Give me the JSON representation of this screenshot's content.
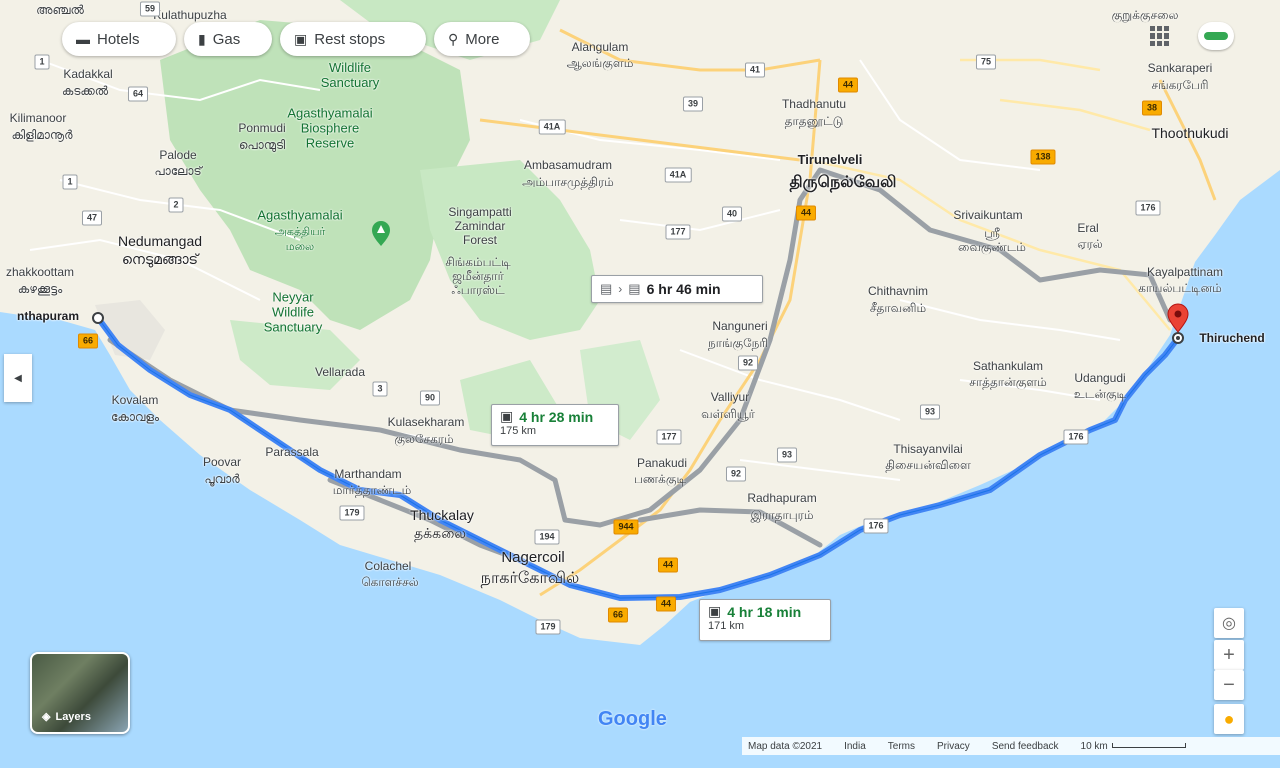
{
  "toolbar": {
    "chips": [
      {
        "label": "Hotels",
        "icon": "bed-icon"
      },
      {
        "label": "Gas",
        "icon": "gas-station-icon"
      },
      {
        "label": "Rest stops",
        "icon": "car-icon"
      },
      {
        "label": "More",
        "icon": "search-icon"
      }
    ]
  },
  "routes": {
    "transit": {
      "time": "6 hr 46 min"
    },
    "alt": {
      "time": "4 hr 28 min",
      "distance": "175 km"
    },
    "main": {
      "time": "4 hr 18 min",
      "distance": "171 km"
    }
  },
  "places": {
    "origin": "nthapuram",
    "destination": "Thiruchend",
    "kulathupuzha": "Kulathupuzha",
    "alangulam": "Alangulam",
    "alangulam_ta": "ஆலங்குளம்",
    "kadakkal": "Kadakkal",
    "kadakkal_ml": "കടക്കൽ",
    "kilimanoor": "Kilimanoor",
    "kilimanoor_ml": "കിളിമാനൂർ",
    "ponmudi": "Ponmudi",
    "ponmudi_ml": "പൊന്മുടി",
    "palode": "Palode",
    "palode_ml": "പാലോട്",
    "nedumangad": "Nedumangad",
    "nedumangad_ml": "നെടുമങ്ങാട്",
    "kazhakkoottam": "zhakkoottam",
    "kazhakkoottam_ml": "കഴക്കൂട്ടം",
    "kovalam": "Kovalam",
    "kovalam_ml": "കോവളം",
    "poovar": "Poovar",
    "poovar_ml": "പൂവാർ",
    "parassala": "Parassala",
    "vellarada": "Vellarada",
    "wildlife_sanctuary": "Wildlife\nSanctuary",
    "agasthyamalai_biosphere": "Agasthyamalai\nBiosphere\nReserve",
    "agasthyamalai": "Agasthyamalai",
    "agasthyamalai_ta": "அகத்தியர்\nமலை",
    "neyyar": "Neyyar\nWildlife\nSanctuary",
    "singampatti": "Singampatti\nZamindar\nForest",
    "singampatti_ta": "சிங்கம்பட்டி\nஜமீன்தார்\nஃபாரஸ்ட்",
    "ambasamudram": "Ambasamudram",
    "ambasamudram_ta": "அம்பாசமுத்திரம்",
    "thadhanutu": "Thadhanutu",
    "thadhanutu_ta": "தாதனூட்டு",
    "tirunelveli": "Tirunelveli",
    "tirunelveli_ta": "திருநெல்வேலி",
    "sankaraperi": "Sankaraperi",
    "sankaraperi_ta": "சங்கரபேரி",
    "thoothukudi": "Thoothukudi",
    "kurukkusalai_ta": "குறுக்குசலை",
    "srivaikuntam": "Srivaikuntam",
    "srivaikuntam_ta": "ஸ்ரீ\nவைகுண்டம்",
    "eral": "Eral",
    "eral_ta": "ஏரல்",
    "kayalpattinam": "Kayalpattinam",
    "kayalpattinam_ta": "காயல்பட்டினம்",
    "chithavnim": "Chithavnim",
    "chithavnim_ta": "சீதாவனிம்",
    "nanguneri": "Nanguneri",
    "nanguneri_ta": "நாங்குநேரி",
    "valliyur": "Valliyur",
    "valliyur_ta": "வள்ளியூர்",
    "sathankulam": "Sathankulam",
    "sathankulam_ta": "சாத்தான்குளம்",
    "udangudi": "Udangudi",
    "udangudi_ta": "உடன்குடி",
    "kulasekharam": "Kulasekharam",
    "kulasekharam_ta": "குலசேகரம்",
    "marthandam": "Marthandam",
    "marthandam_ta": "மார்த்தாண்டம்",
    "thuckalay": "Thuckalay",
    "thuckalay_ta": "தக்கலை",
    "panakudi": "Panakudi",
    "panakudi_ta": "பணக்குடி",
    "thisayanvilai": "Thisayanvilai",
    "thisayanvilai_ta": "திசையன்விளை",
    "radhapuram": "Radhapuram",
    "radhapuram_ta": "இராதாபுரம்",
    "nagercoil": "Nagercoil",
    "nagercoil_ta": "நாகர்கோவில்",
    "colachel": "Colachel",
    "colachel_ta": "கொளச்சல்",
    "anchal_ml": "അഞ്ചൽ"
  },
  "shields": {
    "s59": "59",
    "s1": "1",
    "s64": "64",
    "s1b": "1",
    "s2": "2",
    "s47": "47",
    "s66a": "66",
    "s3": "3",
    "s90": "90",
    "s179a": "179",
    "s179b": "179",
    "s66b": "66",
    "s44a": "44",
    "s44b": "44",
    "s194": "194",
    "s944": "944",
    "s177": "177",
    "s40": "40",
    "s41a": "41A",
    "s41b": "41A",
    "s39": "39",
    "s41": "41",
    "s44c": "44",
    "s75": "75",
    "s38": "38",
    "s138": "138",
    "s176a": "176",
    "s176b": "176",
    "s176c": "176",
    "s93a": "93",
    "s93b": "93",
    "s92a": "92",
    "s92b": "92",
    "s177b": "177",
    "s40b": "40",
    "s44d": "44"
  },
  "layers": {
    "label": "Layers"
  },
  "footer": {
    "map_data": "Map data ©2021",
    "india": "India",
    "terms": "Terms",
    "privacy": "Privacy",
    "feedback": "Send feedback",
    "scale": "10 km"
  },
  "brand": {
    "google": "Google"
  },
  "colors": {
    "route": "#4285f4",
    "alt_route": "#9aa0a6",
    "sea": "#aadaff",
    "land": "#f1efe4",
    "forest": "#c3e5be",
    "marker": "#ea4335"
  }
}
